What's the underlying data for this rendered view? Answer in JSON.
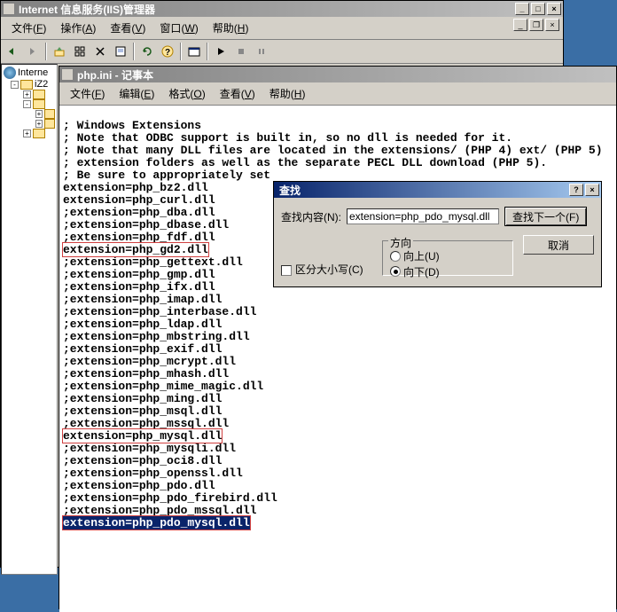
{
  "iis": {
    "title": "Internet 信息服务(IIS)管理器",
    "menu": [
      {
        "label": "文件",
        "hk": "F"
      },
      {
        "label": "操作",
        "hk": "A"
      },
      {
        "label": "查看",
        "hk": "V"
      },
      {
        "label": "窗口",
        "hk": "W"
      },
      {
        "label": "帮助",
        "hk": "H"
      }
    ],
    "tree": {
      "root": "Interne",
      "node": "iZ2"
    }
  },
  "notepad": {
    "title": "php.ini - 记事本",
    "menu": [
      {
        "label": "文件",
        "hk": "F"
      },
      {
        "label": "编辑",
        "hk": "E"
      },
      {
        "label": "格式",
        "hk": "O"
      },
      {
        "label": "查看",
        "hk": "V"
      },
      {
        "label": "帮助",
        "hk": "H"
      }
    ],
    "lines": [
      "",
      "; Windows Extensions",
      "; Note that ODBC support is built in, so no dll is needed for it.",
      "; Note that many DLL files are located in the extensions/ (PHP 4) ext/ (PHP 5)",
      "; extension folders as well as the separate PECL DLL download (PHP 5).",
      "; Be sure to appropriately set",
      "extension=php_bz2.dll",
      "extension=php_curl.dll",
      ";extension=php_dba.dll",
      ";extension=php_dbase.dll",
      ";extension=php_fdf.dll"
    ],
    "hl1": "extension=php_gd2.dll",
    "mid": [
      ";extension=php_gettext.dll",
      ";extension=php_gmp.dll",
      ";extension=php_ifx.dll",
      ";extension=php_imap.dll",
      ";extension=php_interbase.dll",
      ";extension=php_ldap.dll",
      ";extension=php_mbstring.dll",
      ";extension=php_exif.dll",
      ";extension=php_mcrypt.dll",
      ";extension=php_mhash.dll",
      ";extension=php_mime_magic.dll",
      ";extension=php_ming.dll",
      ";extension=php_msql.dll",
      ";extension=php_mssql.dll"
    ],
    "hl2": "extension=php_mysql.dll",
    "mid2": [
      ";extension=php_mysqli.dll",
      ";extension=php_oci8.dll",
      ";extension=php_openssl.dll",
      ";extension=php_pdo.dll",
      ";extension=php_pdo_firebird.dll",
      ";extension=php_pdo_mssql.dll"
    ],
    "sel": "extension=php_pdo_mysql.dll"
  },
  "find": {
    "title": "查找",
    "content_label": "查找内容(N):",
    "content_value": "extension=php_pdo_mysql.dll",
    "match_case": "区分大小写(C)",
    "direction_label": "方向",
    "dir_up": "向上(U)",
    "dir_down": "向下(D)",
    "btn_next": "查找下一个(F)",
    "btn_cancel": "取消"
  }
}
